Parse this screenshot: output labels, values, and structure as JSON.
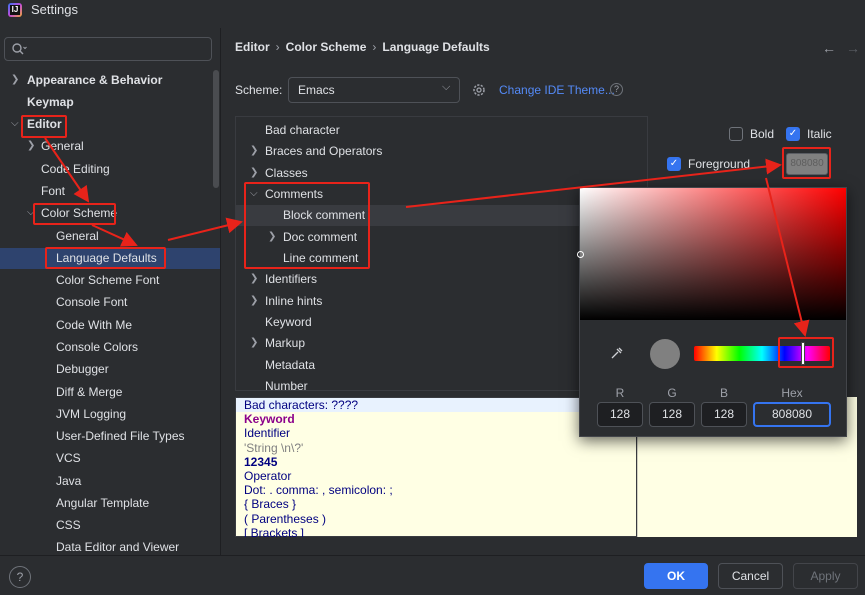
{
  "window": {
    "title": "Settings",
    "app_icon": "intellij-app-icon"
  },
  "search": {
    "placeholder": "",
    "value": ""
  },
  "sidebar": {
    "items": [
      {
        "label": "Appearance & Behavior",
        "bold": true,
        "expandable": true,
        "expanded": false
      },
      {
        "label": "Keymap",
        "bold": true
      },
      {
        "label": "Editor",
        "bold": true,
        "expandable": true,
        "expanded": true
      },
      {
        "label": "General",
        "expandable": true,
        "expanded": false
      },
      {
        "label": "Code Editing"
      },
      {
        "label": "Font"
      },
      {
        "label": "Color Scheme",
        "expandable": true,
        "expanded": true
      },
      {
        "label": "General"
      },
      {
        "label": "Language Defaults",
        "selected": true
      },
      {
        "label": "Color Scheme Font"
      },
      {
        "label": "Console Font"
      },
      {
        "label": "Code With Me"
      },
      {
        "label": "Console Colors"
      },
      {
        "label": "Debugger"
      },
      {
        "label": "Diff & Merge"
      },
      {
        "label": "JVM Logging"
      },
      {
        "label": "User-Defined File Types"
      },
      {
        "label": "VCS"
      },
      {
        "label": "Java"
      },
      {
        "label": "Angular Template"
      },
      {
        "label": "CSS"
      },
      {
        "label": "Data Editor and Viewer"
      }
    ]
  },
  "header": {
    "breadcrumb": [
      "Editor",
      "Color Scheme",
      "Language Defaults"
    ],
    "sep": "›"
  },
  "scheme": {
    "label": "Scheme:",
    "value": "Emacs",
    "change_theme_link": "Change IDE Theme..."
  },
  "elements_tree": {
    "items": [
      {
        "label": "Bad character"
      },
      {
        "label": "Braces and Operators",
        "expandable": true
      },
      {
        "label": "Classes",
        "expandable": true
      },
      {
        "label": "Comments",
        "expandable": true,
        "expanded": true
      },
      {
        "label": "Block comment",
        "selected": true
      },
      {
        "label": "Doc comment",
        "expandable": true
      },
      {
        "label": "Line comment"
      },
      {
        "label": "Identifiers",
        "expandable": true
      },
      {
        "label": "Inline hints",
        "expandable": true
      },
      {
        "label": "Keyword"
      },
      {
        "label": "Markup",
        "expandable": true
      },
      {
        "label": "Metadata"
      },
      {
        "label": "Number"
      }
    ]
  },
  "options": {
    "bold_label": "Bold",
    "bold_checked": false,
    "italic_label": "Italic",
    "italic_checked": true,
    "foreground_label": "Foreground",
    "foreground_checked": true,
    "foreground_swatch_text": "808080",
    "foreground_color": "#808080"
  },
  "preview": {
    "lines": [
      {
        "text": "Bad characters: ????",
        "color": "#000080"
      },
      {
        "text": "Keyword",
        "color": "#8b008b"
      },
      {
        "text": "Identifier",
        "color": "#000080"
      },
      {
        "text": "'String \\n\\?'",
        "color": "#808080"
      },
      {
        "text": "12345",
        "color": "#000080"
      },
      {
        "text": "Operator",
        "color": "#000080"
      },
      {
        "text": "Dot: . comma: , semicolon: ;",
        "color": "#000080"
      },
      {
        "text": "{ Braces }",
        "color": "#000080"
      },
      {
        "text": "( Parentheses )",
        "color": "#000080"
      },
      {
        "text": "[ Brackets ]",
        "color": "#000080"
      }
    ]
  },
  "color_picker": {
    "r_label": "R",
    "g_label": "G",
    "b_label": "B",
    "hex_label": "Hex",
    "r": "128",
    "g": "128",
    "b": "128",
    "hex": "808080",
    "current_color": "#808080"
  },
  "footer": {
    "help": "?",
    "ok": "OK",
    "cancel": "Cancel",
    "apply": "Apply"
  },
  "colors": {
    "accent": "#3574f0",
    "annotation": "#e8231a",
    "background": "#2b2d30",
    "selection": "#2e436e"
  }
}
